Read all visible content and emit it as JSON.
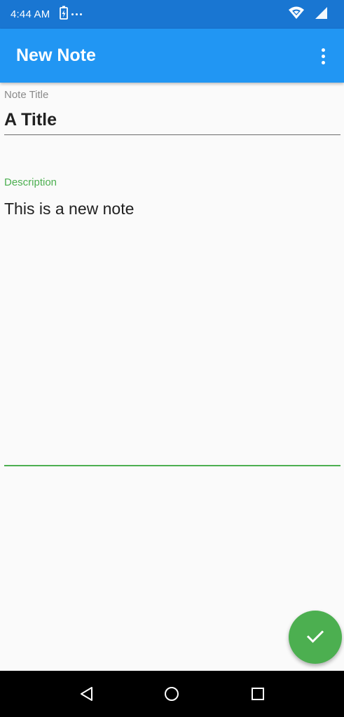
{
  "status_bar": {
    "time": "4:44 AM",
    "icons": [
      "battery-charging-icon",
      "more-notifications-icon",
      "wifi-icon",
      "cell-signal-icon"
    ],
    "color": "#1976d2"
  },
  "app_bar": {
    "title": "New Note",
    "overflow_icon": "more-vert-icon",
    "color": "#2196f3"
  },
  "form": {
    "title_field": {
      "label": "Note Title",
      "value": "A Title"
    },
    "description_field": {
      "label": "Description",
      "value": "This is a new note",
      "accent_color": "#4caf50"
    }
  },
  "fab": {
    "icon": "check-icon",
    "color": "#4caf50"
  },
  "nav_bar": {
    "buttons": [
      "back-icon",
      "home-icon",
      "recents-icon"
    ]
  }
}
